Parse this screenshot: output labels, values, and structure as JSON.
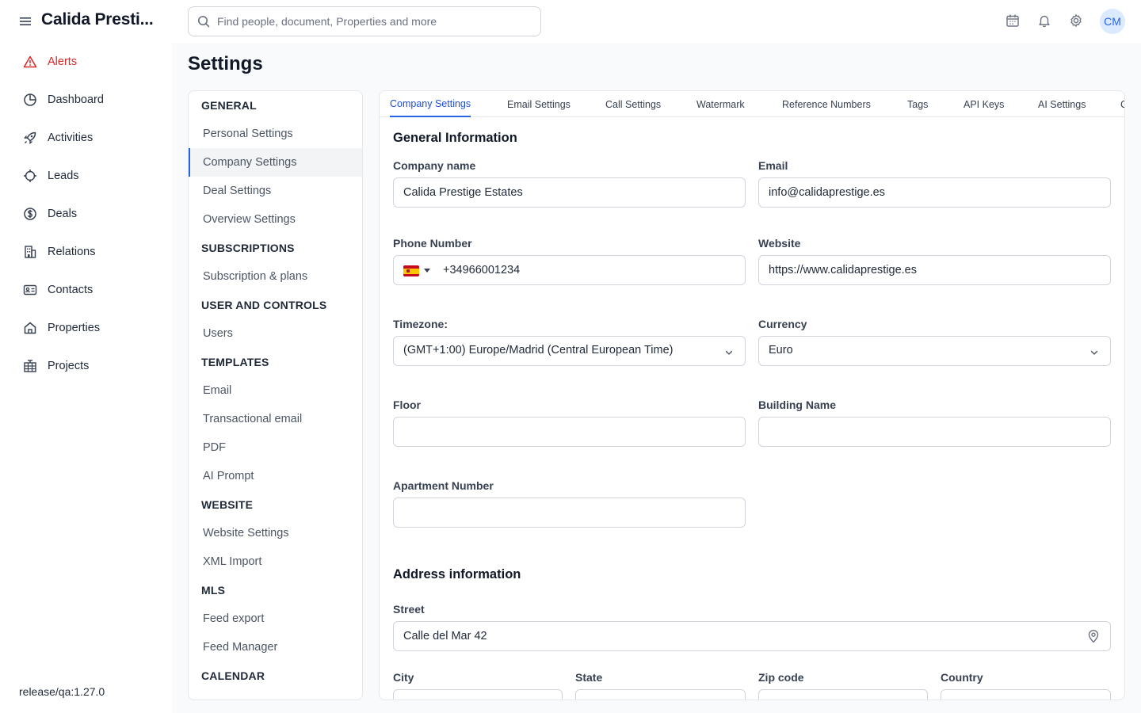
{
  "app": {
    "name": "Calida Presti...",
    "release": "release/qa:1.27.0"
  },
  "search": {
    "placeholder": "Find people, document, Properties and more"
  },
  "header_icons": [
    "calendar-icon",
    "bell-icon",
    "gear-icon"
  ],
  "user": {
    "initials": "CM"
  },
  "nav": {
    "items": [
      {
        "label": "Alerts",
        "icon": "alert-triangle-icon",
        "color": "#dc2626"
      },
      {
        "label": "Dashboard",
        "icon": "pie-chart-icon"
      },
      {
        "label": "Activities",
        "icon": "rocket-icon"
      },
      {
        "label": "Leads",
        "icon": "target-icon"
      },
      {
        "label": "Deals",
        "icon": "dollar-icon"
      },
      {
        "label": "Relations",
        "icon": "building-icon"
      },
      {
        "label": "Contacts",
        "icon": "id-card-icon"
      },
      {
        "label": "Properties",
        "icon": "home-icon"
      },
      {
        "label": "Projects",
        "icon": "city-icon"
      }
    ]
  },
  "page": {
    "title": "Settings"
  },
  "submenu": {
    "general": {
      "heading": "GENERAL",
      "items": [
        "Personal Settings",
        "Company Settings",
        "Deal Settings",
        "Overview Settings"
      ]
    },
    "subscriptions": {
      "heading": "SUBSCRIPTIONS",
      "items": [
        "Subscription & plans"
      ]
    },
    "users": {
      "heading": "USER AND CONTROLS",
      "items": [
        "Users"
      ]
    },
    "templates": {
      "heading": "TEMPLATES",
      "items": [
        "Email",
        "Transactional email",
        "PDF",
        "AI Prompt"
      ]
    },
    "website": {
      "heading": "WEBSITE",
      "items": [
        "Website Settings",
        "XML Import"
      ]
    },
    "mls": {
      "heading": "MLS",
      "items": [
        "Feed export",
        "Feed Manager"
      ]
    },
    "calendar": {
      "heading": "CALENDAR"
    },
    "active": "Company Settings"
  },
  "tabs": [
    "Company Settings",
    "Email Settings",
    "Call Settings",
    "Watermark",
    "Reference Numbers",
    "Tags",
    "API Keys",
    "AI Settings",
    "C"
  ],
  "general_info": {
    "title": "General Information",
    "company_name": {
      "label": "Company name",
      "value": "Calida Prestige Estates"
    },
    "email": {
      "label": "Email",
      "value": "info@calidaprestige.es"
    },
    "phone": {
      "label": "Phone Number",
      "value": "+34966001234",
      "country": "ES"
    },
    "website": {
      "label": "Website",
      "value": "https://www.calidaprestige.es"
    },
    "timezone": {
      "label": "Timezone:",
      "value": "(GMT+1:00) Europe/Madrid (Central European Time)"
    },
    "currency": {
      "label": "Currency",
      "value": "Euro"
    },
    "floor": {
      "label": "Floor",
      "value": ""
    },
    "building": {
      "label": "Building Name",
      "value": ""
    },
    "apartment": {
      "label": "Apartment Number",
      "value": ""
    }
  },
  "address": {
    "title": "Address information",
    "street": {
      "label": "Street",
      "value": "Calle del Mar 42"
    },
    "city": {
      "label": "City"
    },
    "state": {
      "label": "State"
    },
    "zip": {
      "label": "Zip code"
    },
    "country": {
      "label": "Country"
    }
  }
}
